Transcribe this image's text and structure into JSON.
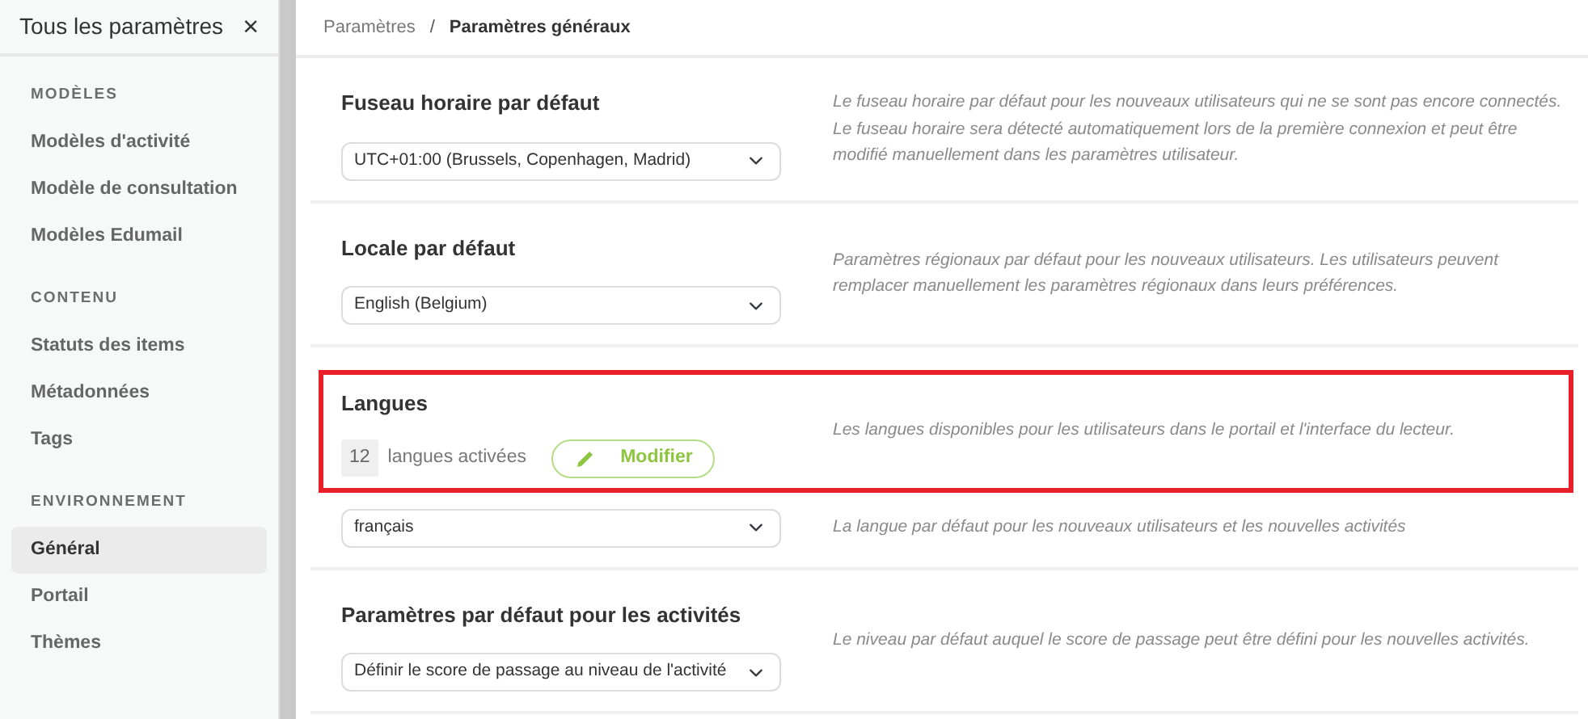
{
  "sidebar": {
    "title": "Tous les paramètres",
    "close": "×",
    "groups": [
      {
        "heading": "MODÈLES",
        "items": [
          {
            "label": "Modèles d'activité",
            "selected": false
          },
          {
            "label": "Modèle de consultation",
            "selected": false
          },
          {
            "label": "Modèles Edumail",
            "selected": false
          }
        ]
      },
      {
        "heading": "CONTENU",
        "items": [
          {
            "label": "Statuts des items",
            "selected": false
          },
          {
            "label": "Métadonnées",
            "selected": false
          },
          {
            "label": "Tags",
            "selected": false
          }
        ]
      },
      {
        "heading": "ENVIRONNEMENT",
        "items": [
          {
            "label": "Général",
            "selected": true
          },
          {
            "label": "Portail",
            "selected": false
          },
          {
            "label": "Thèmes",
            "selected": false
          }
        ]
      }
    ]
  },
  "breadcrumb": [
    {
      "label": "Paramètres",
      "current": false
    },
    {
      "label": "Paramètres généraux",
      "current": true
    }
  ],
  "breadcrumb_separator": "/",
  "sections": [
    {
      "kind": "select",
      "title": "Fuseau horaire par défaut",
      "value": "UTC+01:00 (Brussels, Copenhagen, Madrid)",
      "description": "Le fuseau horaire par défaut pour les nouveaux utilisateurs qui ne se sont pas encore connectés. Le fuseau horaire sera détecté automatiquement lors de la première connexion et peut être modifié manuellement dans les paramètres utilisateur.",
      "highlighted": false
    },
    {
      "kind": "select",
      "title": "Locale par défaut",
      "value": "English (Belgium)",
      "description": "Paramètres régionaux par défaut pour les nouveaux utilisateurs. Les utilisateurs peuvent remplacer manuellement les paramètres régionaux dans leurs préférences.",
      "highlighted": false
    },
    {
      "kind": "languages",
      "title": "Langues",
      "count": "12",
      "count_label": "langues activées",
      "button": "Modifier",
      "description": "Les langues disponibles pour les utilisateurs dans le portail et l'interface du lecteur.",
      "highlighted": true
    },
    {
      "kind": "select",
      "value": "français",
      "description": "La langue par défaut pour les nouveaux utilisateurs et les nouvelles activités",
      "highlighted": false
    },
    {
      "kind": "select",
      "title": "Paramètres par défaut pour les activités",
      "value": "Définir le score de passage au niveau de l'activité",
      "description": "Le niveau par défaut auquel le score de passage peut être défini pour les nouvelles activités.",
      "highlighted": false
    }
  ]
}
